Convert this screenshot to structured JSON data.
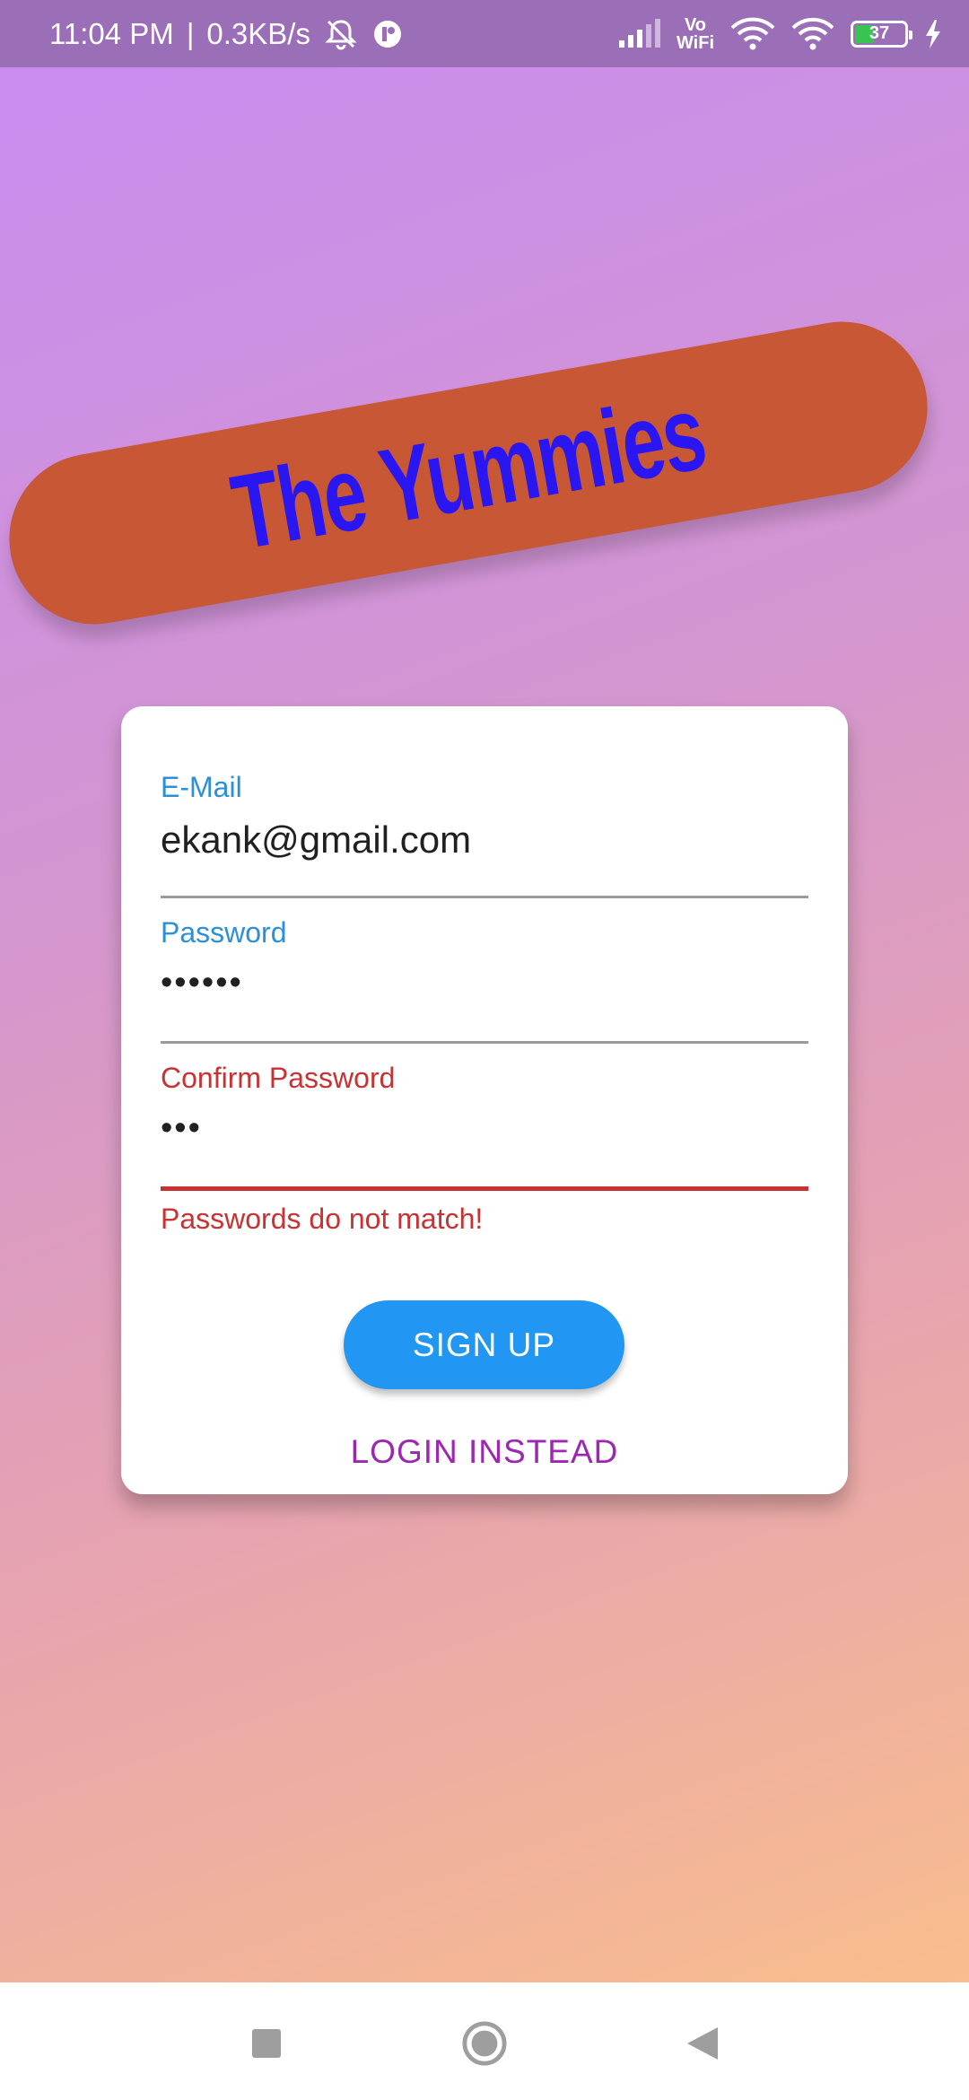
{
  "status_bar": {
    "time": "11:04 PM",
    "separator": "|",
    "net_speed": "0.3KB/s",
    "volte_top": "Vo",
    "volte_bottom": "WiFi",
    "battery_level": "37"
  },
  "logo": {
    "text": "The Yummies",
    "colors": {
      "banner": "#c75735",
      "text": "#2a16f0"
    }
  },
  "form": {
    "email": {
      "label": "E-Mail",
      "value": "ekank@gmail.com"
    },
    "password": {
      "label": "Password",
      "value": "••••••"
    },
    "confirm_password": {
      "label": "Confirm Password",
      "value": "•••",
      "error": "Passwords do not match!"
    },
    "signup_label": "SIGN UP",
    "login_label": "LOGIN INSTEAD"
  },
  "colors": {
    "accent": "#2196f3",
    "error": "#c83232",
    "link": "#9c27b0"
  },
  "nav": {
    "icons": [
      "recent-apps-icon",
      "home-icon",
      "back-icon"
    ]
  }
}
